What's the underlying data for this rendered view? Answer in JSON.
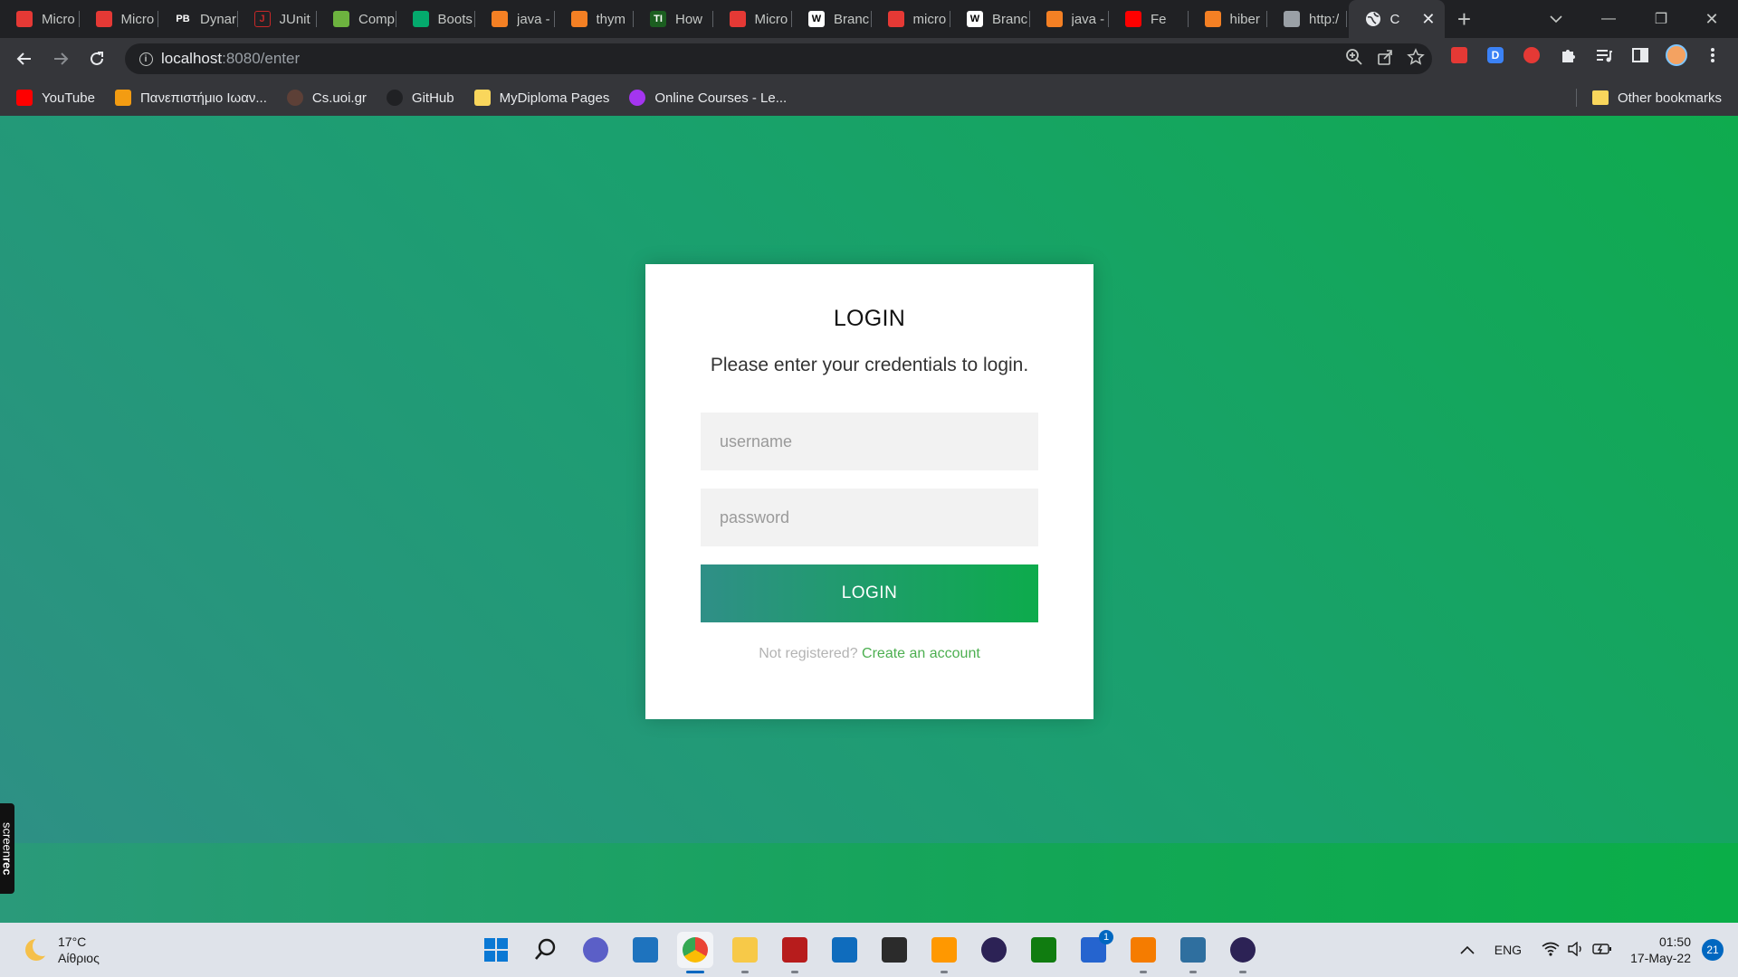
{
  "tabs": [
    {
      "title": "Micro",
      "icon": "pdf-icon",
      "color": "#e53935"
    },
    {
      "title": "Micro",
      "icon": "pdf-icon",
      "color": "#e53935"
    },
    {
      "title": "Dynar",
      "icon": "pb-icon",
      "color": "#202124"
    },
    {
      "title": "JUnit",
      "icon": "junit-icon",
      "color": "#c62828"
    },
    {
      "title": "Comp",
      "icon": "leaf-icon",
      "color": "#6db33f"
    },
    {
      "title": "Boots",
      "icon": "w3-icon",
      "color": "#04aa6d"
    },
    {
      "title": "java -",
      "icon": "stackoverflow-icon",
      "color": "#f48024"
    },
    {
      "title": "thym",
      "icon": "stackoverflow-icon",
      "color": "#f48024"
    },
    {
      "title": "How",
      "icon": "ti-icon",
      "color": "#1b5e20"
    },
    {
      "title": "Micro",
      "icon": "pdf-icon",
      "color": "#e53935"
    },
    {
      "title": "Branc",
      "icon": "wikipedia-icon",
      "color": "#ffffff"
    },
    {
      "title": "micro",
      "icon": "pdf-icon",
      "color": "#e53935"
    },
    {
      "title": "Branc",
      "icon": "wikipedia-icon",
      "color": "#ffffff"
    },
    {
      "title": "java -",
      "icon": "stackoverflow-icon",
      "color": "#f48024"
    },
    {
      "title": "Fe",
      "icon": "youtube-icon",
      "color": "#ff0000"
    },
    {
      "title": "hiber",
      "icon": "stackoverflow-icon",
      "color": "#f48024"
    },
    {
      "title": "http:/",
      "icon": "page-icon",
      "color": "#9aa0a6"
    }
  ],
  "active_tab": {
    "title": "C",
    "icon": "globe-icon"
  },
  "window_controls": {
    "minimize": "—",
    "restore": "❐",
    "close": "✕"
  },
  "address": {
    "host": "localhost",
    "path": ":8080/enter"
  },
  "bookmarks": [
    {
      "label": "YouTube",
      "icon": "youtube-icon",
      "color": "#ff0000"
    },
    {
      "label": "Πανεπιστήμιο Ιωαν...",
      "icon": "university-icon",
      "color": "#f39c12"
    },
    {
      "label": "Cs.uoi.gr",
      "icon": "cs-uoi-icon",
      "color": "#5d4037"
    },
    {
      "label": "GitHub",
      "icon": "github-icon",
      "color": "#202124"
    },
    {
      "label": "MyDiploma Pages",
      "icon": "folder-icon",
      "color": "#f9d65c"
    },
    {
      "label": "Online Courses - Le...",
      "icon": "udemy-icon",
      "color": "#a435f0"
    }
  ],
  "other_bookmarks": "Other bookmarks",
  "login": {
    "title": "LOGIN",
    "subtitle": "Please enter your credentials to login.",
    "username_placeholder": "username",
    "password_placeholder": "password",
    "button": "LOGIN",
    "not_registered": "Not registered?",
    "create_account": "Create an account"
  },
  "screenrec": {
    "a": "screen",
    "b": "rec"
  },
  "weather": {
    "temp": "17°C",
    "desc": "Αίθριος"
  },
  "taskbar": {
    "apps": [
      {
        "name": "start-icon",
        "color": "#0a78d4"
      },
      {
        "name": "search-icon",
        "color": "#1a1a1a"
      },
      {
        "name": "teams-chat-icon",
        "color": "#5b5fc7"
      },
      {
        "name": "store-icon",
        "color": "#1e73be"
      },
      {
        "name": "chrome-icon",
        "color": "#34a853",
        "active": true
      },
      {
        "name": "file-explorer-icon",
        "color": "#f7c948"
      },
      {
        "name": "mysql-workbench-icon",
        "color": "#b71c1c"
      },
      {
        "name": "mail-icon",
        "color": "#0f6cbd"
      },
      {
        "name": "terminal-icon",
        "color": "#2b2b2b"
      },
      {
        "name": "sublime-icon",
        "color": "#ff9800"
      },
      {
        "name": "eclipse-icon",
        "color": "#2c2255"
      },
      {
        "name": "xbox-icon",
        "color": "#107c10"
      },
      {
        "name": "todo-icon",
        "color": "#2564cf",
        "badge": "1"
      },
      {
        "name": "pdf-editor-icon",
        "color": "#f57c00"
      },
      {
        "name": "mysql-icon",
        "color": "#2f6f9f"
      },
      {
        "name": "eclipse-ee-icon",
        "color": "#2c2255"
      }
    ]
  },
  "tray": {
    "lang": "ENG",
    "time": "01:50",
    "date": "17-May-22",
    "notifications": "21"
  }
}
